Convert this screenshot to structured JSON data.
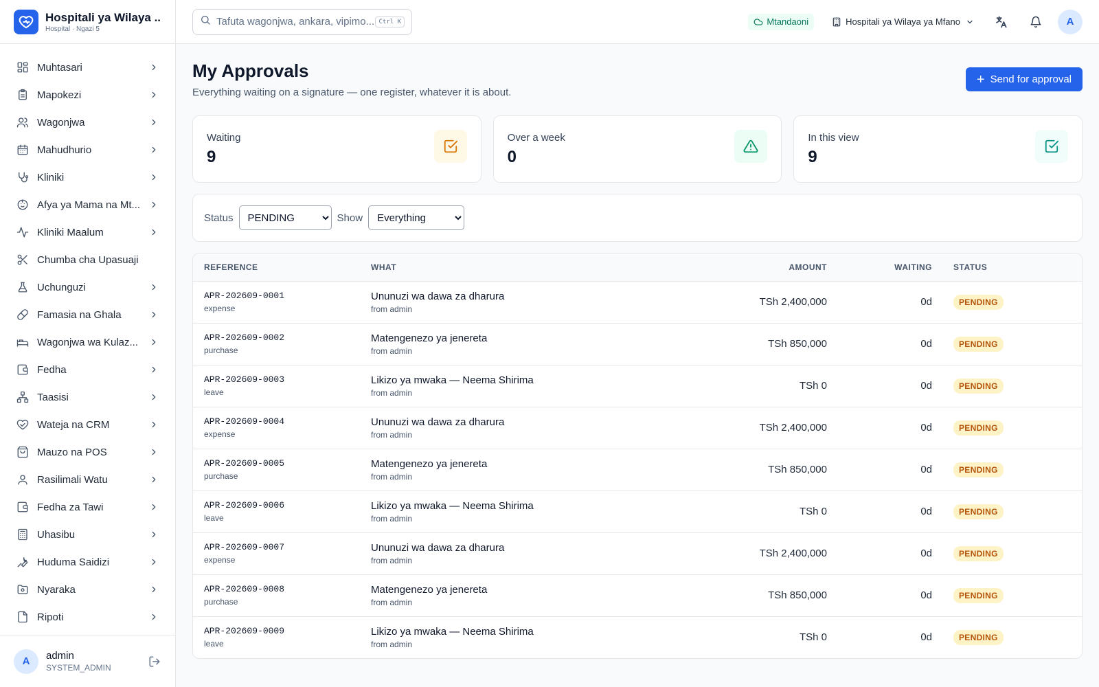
{
  "app": {
    "title": "Hospitali ya Wilaya ...",
    "subtitle": "Hospital · Ngazi 5"
  },
  "sidebar": {
    "items": [
      {
        "label": "Muhtasari",
        "icon": "dashboard-icon",
        "has_children": true
      },
      {
        "label": "Mapokezi",
        "icon": "clipboard-icon",
        "has_children": true
      },
      {
        "label": "Wagonjwa",
        "icon": "users-icon",
        "has_children": true
      },
      {
        "label": "Mahudhurio",
        "icon": "calendar-icon",
        "has_children": true
      },
      {
        "label": "Kliniki",
        "icon": "stethoscope-icon",
        "has_children": true
      },
      {
        "label": "Afya ya Mama na Mt...",
        "icon": "baby-icon",
        "has_children": true
      },
      {
        "label": "Kliniki Maalum",
        "icon": "activity-icon",
        "has_children": true
      },
      {
        "label": "Chumba cha Upasuaji",
        "icon": "scissors-icon",
        "has_children": false
      },
      {
        "label": "Uchunguzi",
        "icon": "flask-icon",
        "has_children": true
      },
      {
        "label": "Famasia na Ghala",
        "icon": "pill-icon",
        "has_children": true
      },
      {
        "label": "Wagonjwa wa Kulaz...",
        "icon": "bed-icon",
        "has_children": true
      },
      {
        "label": "Fedha",
        "icon": "wallet-icon",
        "has_children": true
      },
      {
        "label": "Taasisi",
        "icon": "network-icon",
        "has_children": true
      },
      {
        "label": "Wateja na CRM",
        "icon": "handshake-icon",
        "has_children": true
      },
      {
        "label": "Mauzo na POS",
        "icon": "shopping-bag-icon",
        "has_children": true
      },
      {
        "label": "Rasilimali Watu",
        "icon": "user-icon",
        "has_children": true
      },
      {
        "label": "Fedha za Tawi",
        "icon": "wallet-icon",
        "has_children": true
      },
      {
        "label": "Uhasibu",
        "icon": "calculator-icon",
        "has_children": true
      },
      {
        "label": "Huduma Saidizi",
        "icon": "wrench-icon",
        "has_children": true
      },
      {
        "label": "Nyaraka",
        "icon": "folder-icon",
        "has_children": true
      },
      {
        "label": "Ripoti",
        "icon": "report-icon",
        "has_children": true
      }
    ]
  },
  "user": {
    "initial": "A",
    "name": "admin",
    "role": "SYSTEM_ADMIN"
  },
  "header": {
    "search_placeholder": "Tafuta wagonjwa, ankara, vipimo...",
    "search_shortcut": "Ctrl K",
    "status": "Mtandaoni",
    "facility": "Hospitali ya Wilaya ya Mfano",
    "avatar_initial": "A"
  },
  "page": {
    "title": "My Approvals",
    "subtitle": "Everything waiting on a signature — one register, whatever it is about.",
    "primary_action": "Send for approval"
  },
  "stats": [
    {
      "label": "Waiting",
      "value": "9",
      "icon": "checkbox-icon",
      "color": "#d97706",
      "bg": "#fef9e7"
    },
    {
      "label": "Over a week",
      "value": "0",
      "icon": "warning-icon",
      "color": "#059669",
      "bg": "#ecfdf5"
    },
    {
      "label": "In this view",
      "value": "9",
      "icon": "checkbox-icon",
      "color": "#0d9488",
      "bg": "#f0fdfa"
    }
  ],
  "filters": {
    "status_label": "Status",
    "status_value": "PENDING",
    "show_label": "Show",
    "show_value": "Everything"
  },
  "table": {
    "columns": [
      "REFERENCE",
      "WHAT",
      "AMOUNT",
      "WAITING",
      "STATUS"
    ],
    "rows": [
      {
        "ref": "APR-202609-0001",
        "type": "expense",
        "title": "Ununuzi wa dawa za dharura",
        "from": "from admin",
        "amount": "TSh 2,400,000",
        "waiting": "0d",
        "status": "PENDING"
      },
      {
        "ref": "APR-202609-0002",
        "type": "purchase",
        "title": "Matengenezo ya jenereta",
        "from": "from admin",
        "amount": "TSh 850,000",
        "waiting": "0d",
        "status": "PENDING"
      },
      {
        "ref": "APR-202609-0003",
        "type": "leave",
        "title": "Likizo ya mwaka — Neema Shirima",
        "from": "from admin",
        "amount": "TSh 0",
        "waiting": "0d",
        "status": "PENDING"
      },
      {
        "ref": "APR-202609-0004",
        "type": "expense",
        "title": "Ununuzi wa dawa za dharura",
        "from": "from admin",
        "amount": "TSh 2,400,000",
        "waiting": "0d",
        "status": "PENDING"
      },
      {
        "ref": "APR-202609-0005",
        "type": "purchase",
        "title": "Matengenezo ya jenereta",
        "from": "from admin",
        "amount": "TSh 850,000",
        "waiting": "0d",
        "status": "PENDING"
      },
      {
        "ref": "APR-202609-0006",
        "type": "leave",
        "title": "Likizo ya mwaka — Neema Shirima",
        "from": "from admin",
        "amount": "TSh 0",
        "waiting": "0d",
        "status": "PENDING"
      },
      {
        "ref": "APR-202609-0007",
        "type": "expense",
        "title": "Ununuzi wa dawa za dharura",
        "from": "from admin",
        "amount": "TSh 2,400,000",
        "waiting": "0d",
        "status": "PENDING"
      },
      {
        "ref": "APR-202609-0008",
        "type": "purchase",
        "title": "Matengenezo ya jenereta",
        "from": "from admin",
        "amount": "TSh 850,000",
        "waiting": "0d",
        "status": "PENDING"
      },
      {
        "ref": "APR-202609-0009",
        "type": "leave",
        "title": "Likizo ya mwaka — Neema Shirima",
        "from": "from admin",
        "amount": "TSh 0",
        "waiting": "0d",
        "status": "PENDING"
      }
    ]
  },
  "colors": {
    "accent": "#2563eb",
    "pending_bg": "#fef3c7",
    "pending_text": "#b45309",
    "online_text": "#047857"
  }
}
